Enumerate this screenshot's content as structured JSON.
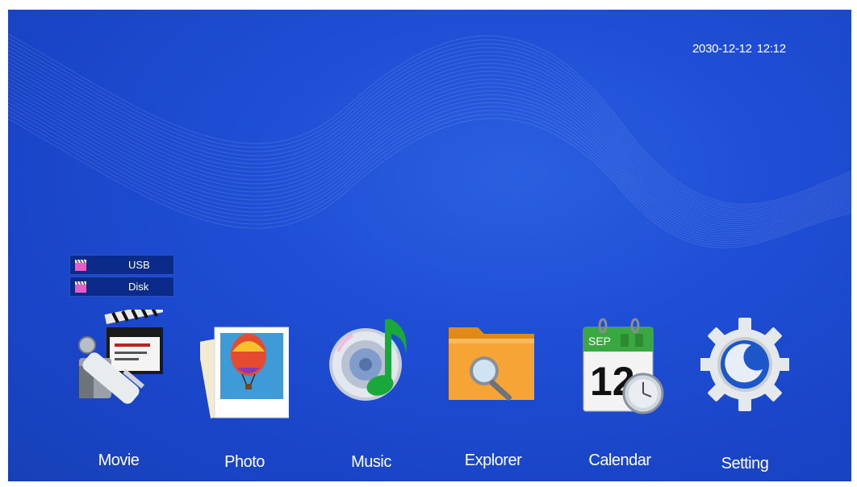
{
  "status": {
    "date": "2030-12-12",
    "time": "12:12"
  },
  "source_menu": [
    {
      "label": "USB",
      "icon": "clapper-icon"
    },
    {
      "label": "Disk",
      "icon": "clapper-icon"
    }
  ],
  "apps": [
    {
      "label": "Movie",
      "icon": "movie-camera-icon"
    },
    {
      "label": "Photo",
      "icon": "photo-balloon-icon"
    },
    {
      "label": "Music",
      "icon": "music-cd-icon"
    },
    {
      "label": "Explorer",
      "icon": "folder-search-icon"
    },
    {
      "label": "Calendar",
      "icon": "calendar-clock-icon",
      "month": "SEP",
      "day": "12"
    },
    {
      "label": "Setting",
      "icon": "gear-icon"
    }
  ],
  "colors": {
    "background": "#1f4fd6",
    "menu_bg": "#0b2b8a",
    "text": "#ffffff"
  }
}
